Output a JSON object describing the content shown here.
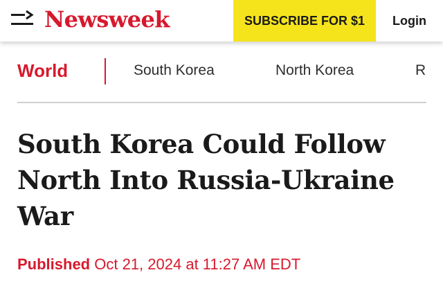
{
  "header": {
    "logo_text": "Newsweek",
    "subscribe_label": "SUBSCRIBE FOR $1",
    "login_label": "Login",
    "menu_icon": "menu-icon"
  },
  "subnav": {
    "section": "World",
    "links": [
      "South Korea",
      "North Korea",
      "R"
    ]
  },
  "article": {
    "headline": "South Korea Could Follow North Into Russia-Ukraine War",
    "published_label": "Published",
    "published_date": "Oct 21, 2024 at 11:27 AM EDT"
  },
  "colors": {
    "brand_red": "#d7192d",
    "subscribe_yellow": "#f5e41c"
  }
}
